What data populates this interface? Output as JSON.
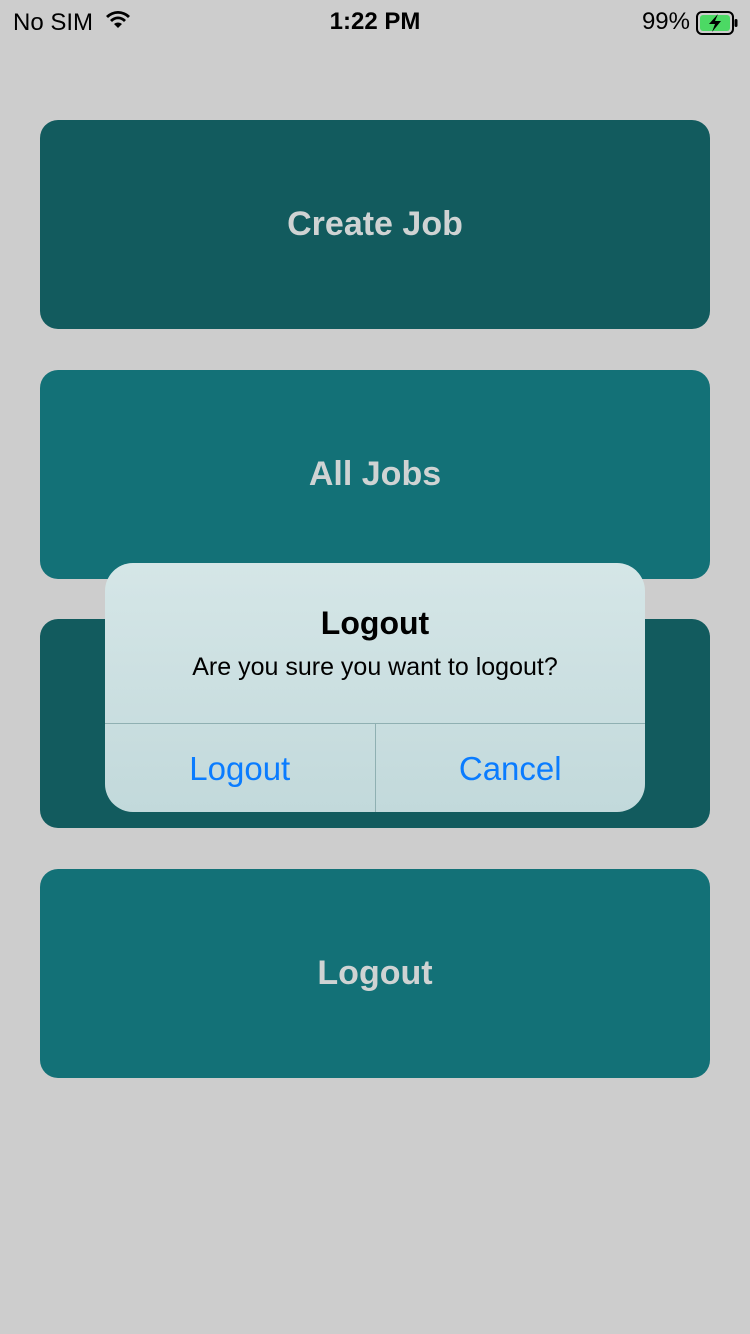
{
  "status_bar": {
    "carrier": "No SIM",
    "time": "1:22 PM",
    "battery_percent": "99%",
    "icons": [
      "wifi-icon",
      "battery-charging-icon"
    ]
  },
  "menu": {
    "items": [
      {
        "label": "Create Job",
        "color": "#125b5e"
      },
      {
        "label": "All Jobs",
        "color": "#137177"
      },
      {
        "label": "",
        "color": "#125b5e"
      },
      {
        "label": "Logout",
        "color": "#137177"
      }
    ]
  },
  "alert": {
    "title": "Logout",
    "message": "Are you sure you want to logout?",
    "actions": [
      {
        "label": "Logout",
        "color": "#0a7cff"
      },
      {
        "label": "Cancel",
        "color": "#0a7cff"
      }
    ]
  },
  "colors": {
    "background": "#cdcdcd",
    "button_text": "#cfd3d3",
    "battery_green": "#4cd964"
  }
}
